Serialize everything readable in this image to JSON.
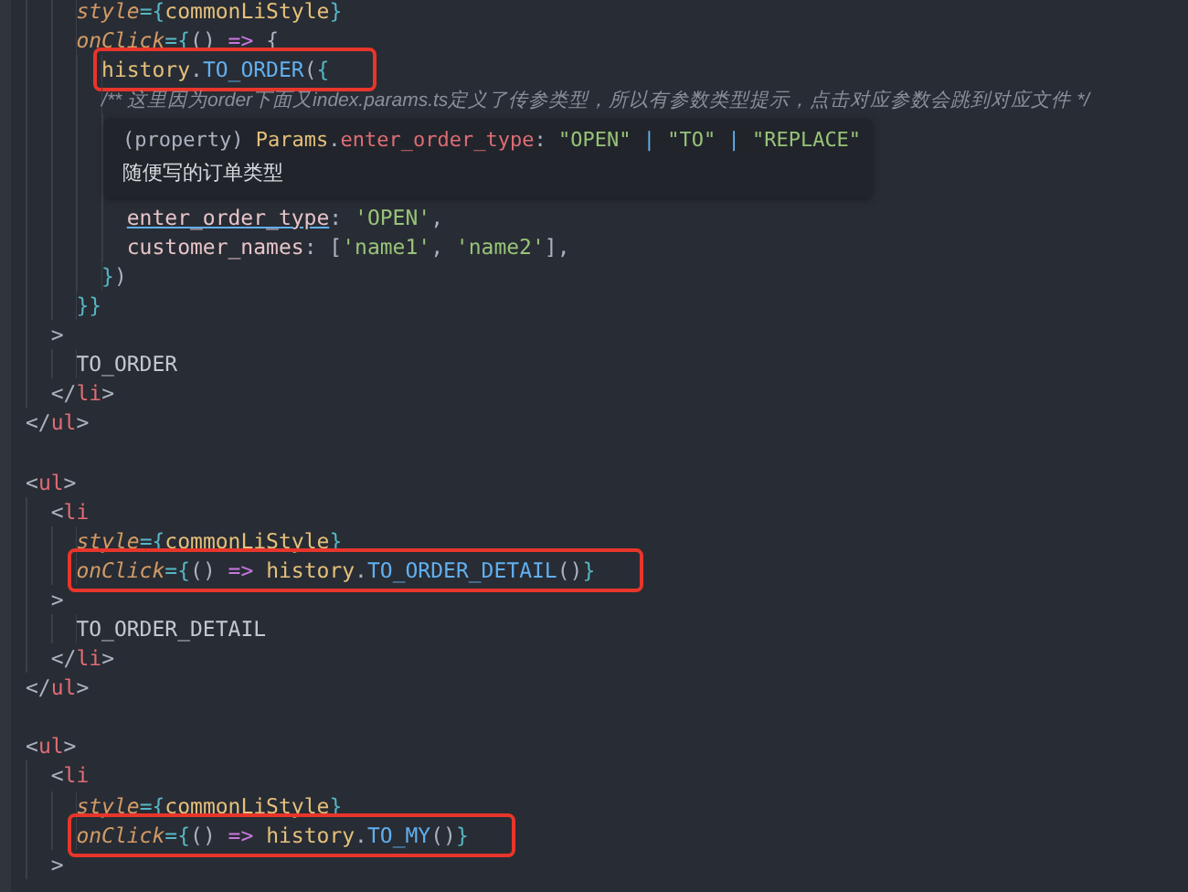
{
  "editor": {
    "lines": [
      {
        "kind": "group",
        "children": [
          {
            "kind": "group",
            "children": [
              {
                "kind": "line",
                "highlighted": false,
                "tokens": [
                  {
                    "kind": "attr",
                    "text": "style"
                  },
                  {
                    "kind": "brace",
                    "text": "={"
                  },
                  {
                    "kind": "var",
                    "text": "commonLiStyle"
                  },
                  {
                    "kind": "brace",
                    "text": "}"
                  }
                ]
              },
              {
                "kind": "line",
                "highlighted": false,
                "tokens": [
                  {
                    "kind": "attr",
                    "text": "onClick"
                  },
                  {
                    "kind": "brace",
                    "text": "={"
                  },
                  {
                    "kind": "punct",
                    "text": "() "
                  },
                  {
                    "kind": "keyword",
                    "text": "=>"
                  },
                  {
                    "kind": "punct",
                    "text": " {"
                  }
                ],
                "children": [
                  {
                    "kind": "line",
                    "highlighted": true,
                    "tokens": [
                      {
                        "kind": "var",
                        "text": "history"
                      },
                      {
                        "kind": "punct",
                        "text": "."
                      },
                      {
                        "kind": "fn",
                        "text": "TO_ORDER"
                      },
                      {
                        "kind": "punct",
                        "text": "("
                      },
                      {
                        "kind": "brace",
                        "text": "{"
                      }
                    ]
                  },
                  {
                    "kind": "line",
                    "highlighted": false,
                    "tokens": [
                      {
                        "kind": "comment",
                        "text": "/** 这里因为order下面又index.params.ts定义了传参类型，所以有参数类型提示，点击对应参数会跳到对应文件 */"
                      }
                    ],
                    "children": [
                      {
                        "kind": "blank",
                        "highlighted": false
                      },
                      {
                        "kind": "blank",
                        "highlighted": false
                      },
                      {
                        "kind": "blank",
                        "highlighted": false
                      },
                      {
                        "kind": "line",
                        "highlighted": false,
                        "tokens": [
                          {
                            "kind": "propref",
                            "text": "enter_order_type"
                          },
                          {
                            "kind": "punct",
                            "text": ": "
                          },
                          {
                            "kind": "string",
                            "text": "'OPEN'"
                          },
                          {
                            "kind": "punct",
                            "text": ","
                          }
                        ]
                      },
                      {
                        "kind": "line",
                        "highlighted": false,
                        "tokens": [
                          {
                            "kind": "prop",
                            "text": "customer_names"
                          },
                          {
                            "kind": "punct",
                            "text": ": ["
                          },
                          {
                            "kind": "string",
                            "text": "'name1'"
                          },
                          {
                            "kind": "punct",
                            "text": ", "
                          },
                          {
                            "kind": "string",
                            "text": "'name2'"
                          },
                          {
                            "kind": "punct",
                            "text": "],"
                          }
                        ]
                      }
                    ]
                  },
                  {
                    "kind": "line",
                    "highlighted": false,
                    "tokens": [
                      {
                        "kind": "brace",
                        "text": "}"
                      },
                      {
                        "kind": "punct",
                        "text": ")"
                      }
                    ]
                  }
                ]
              },
              {
                "kind": "line",
                "highlighted": false,
                "tokens": [
                  {
                    "kind": "brace",
                    "text": "}}"
                  }
                ]
              }
            ]
          },
          {
            "kind": "line",
            "highlighted": false,
            "tokens": [
              {
                "kind": "punct",
                "text": ">"
              }
            ],
            "children": [
              {
                "kind": "line",
                "highlighted": false,
                "tokens": [
                  {
                    "kind": "text",
                    "text": "TO_ORDER"
                  }
                ]
              }
            ]
          },
          {
            "kind": "line",
            "highlighted": false,
            "tokens": [
              {
                "kind": "punct",
                "text": "</"
              },
              {
                "kind": "tag",
                "text": "li"
              },
              {
                "kind": "punct",
                "text": ">"
              }
            ]
          }
        ]
      },
      {
        "kind": "line",
        "highlighted": false,
        "tokens": [
          {
            "kind": "punct",
            "text": "</"
          },
          {
            "kind": "tag",
            "text": "ul"
          },
          {
            "kind": "punct",
            "text": ">"
          }
        ]
      },
      {
        "kind": "blank",
        "highlighted": false
      },
      {
        "kind": "line",
        "highlighted": false,
        "tokens": [
          {
            "kind": "punct",
            "text": "<"
          },
          {
            "kind": "tag",
            "text": "ul"
          },
          {
            "kind": "punct",
            "text": ">"
          }
        ],
        "children": [
          {
            "kind": "line",
            "highlighted": false,
            "tokens": [
              {
                "kind": "punct",
                "text": "<"
              },
              {
                "kind": "tag",
                "text": "li"
              }
            ],
            "children": [
              {
                "kind": "line",
                "highlighted": false,
                "tokens": [
                  {
                    "kind": "attr",
                    "text": "style"
                  },
                  {
                    "kind": "brace",
                    "text": "={"
                  },
                  {
                    "kind": "var",
                    "text": "commonLiStyle"
                  },
                  {
                    "kind": "brace",
                    "text": "}"
                  }
                ]
              },
              {
                "kind": "line",
                "highlighted": true,
                "tokens": [
                  {
                    "kind": "attr",
                    "text": "onClick"
                  },
                  {
                    "kind": "brace",
                    "text": "={"
                  },
                  {
                    "kind": "punct",
                    "text": "() "
                  },
                  {
                    "kind": "keyword",
                    "text": "=>"
                  },
                  {
                    "kind": "var",
                    "text": " history"
                  },
                  {
                    "kind": "punct",
                    "text": "."
                  },
                  {
                    "kind": "fn",
                    "text": "TO_ORDER_DETAIL"
                  },
                  {
                    "kind": "punct",
                    "text": "()"
                  },
                  {
                    "kind": "brace",
                    "text": "}"
                  }
                ]
              }
            ]
          },
          {
            "kind": "line",
            "highlighted": false,
            "tokens": [
              {
                "kind": "punct",
                "text": ">"
              }
            ],
            "children": [
              {
                "kind": "line",
                "highlighted": false,
                "tokens": [
                  {
                    "kind": "text",
                    "text": "TO_ORDER_DETAIL"
                  }
                ]
              }
            ]
          },
          {
            "kind": "line",
            "highlighted": false,
            "tokens": [
              {
                "kind": "punct",
                "text": "</"
              },
              {
                "kind": "tag",
                "text": "li"
              },
              {
                "kind": "punct",
                "text": ">"
              }
            ]
          }
        ]
      },
      {
        "kind": "line",
        "highlighted": false,
        "tokens": [
          {
            "kind": "punct",
            "text": "</"
          },
          {
            "kind": "tag",
            "text": "ul"
          },
          {
            "kind": "punct",
            "text": ">"
          }
        ]
      },
      {
        "kind": "blank",
        "highlighted": false
      },
      {
        "kind": "line",
        "highlighted": false,
        "tokens": [
          {
            "kind": "punct",
            "text": "<"
          },
          {
            "kind": "tag",
            "text": "ul"
          },
          {
            "kind": "punct",
            "text": ">"
          }
        ],
        "children": [
          {
            "kind": "line",
            "highlighted": false,
            "tokens": [
              {
                "kind": "punct",
                "text": "<"
              },
              {
                "kind": "tag",
                "text": "li"
              }
            ],
            "children": [
              {
                "kind": "line",
                "highlighted": false,
                "tokens": [
                  {
                    "kind": "attr",
                    "text": "style"
                  },
                  {
                    "kind": "brace",
                    "text": "={"
                  },
                  {
                    "kind": "var",
                    "text": "commonLiStyle"
                  },
                  {
                    "kind": "brace",
                    "text": "}"
                  }
                ]
              },
              {
                "kind": "line",
                "highlighted": true,
                "tokens": [
                  {
                    "kind": "attr",
                    "text": "onClick"
                  },
                  {
                    "kind": "brace",
                    "text": "={"
                  },
                  {
                    "kind": "punct",
                    "text": "() "
                  },
                  {
                    "kind": "keyword",
                    "text": "=>"
                  },
                  {
                    "kind": "var",
                    "text": " history"
                  },
                  {
                    "kind": "punct",
                    "text": "."
                  },
                  {
                    "kind": "fn",
                    "text": "TO_MY"
                  },
                  {
                    "kind": "punct",
                    "text": "()"
                  },
                  {
                    "kind": "brace",
                    "text": "}"
                  }
                ]
              }
            ]
          },
          {
            "kind": "line",
            "highlighted": false,
            "tokens": [
              {
                "kind": "punct",
                "text": ">"
              }
            ]
          }
        ]
      }
    ]
  },
  "tooltip": {
    "signature": [
      {
        "kind": "punct",
        "text": "(property) "
      },
      {
        "kind": "type",
        "text": "Params"
      },
      {
        "kind": "punct",
        "text": "."
      },
      {
        "kind": "prop2",
        "text": "enter_order_type"
      },
      {
        "kind": "punct",
        "text": ": "
      },
      {
        "kind": "string",
        "text": "\"OPEN\""
      },
      {
        "kind": "bar",
        "text": " | "
      },
      {
        "kind": "string",
        "text": "\"TO\""
      },
      {
        "kind": "bar",
        "text": " | "
      },
      {
        "kind": "string",
        "text": "\"REPLACE\""
      }
    ],
    "description": "随便写的订单类型"
  }
}
